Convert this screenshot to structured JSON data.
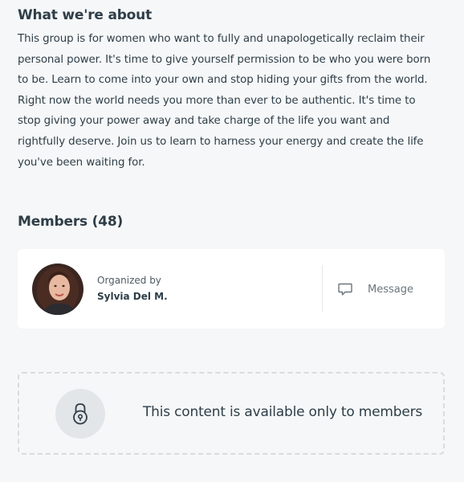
{
  "about": {
    "heading": "What we're about",
    "lines": [
      "This group is for women who want to fully and unapologetically reclaim their",
      "personal power. It's time to give yourself permission to be who you were born",
      "to be. Learn to come into your own and stop hiding your gifts from the world.",
      "Right now the world needs you more than ever to be authentic. It's time to",
      "stop giving your power away and take charge of the life you want and",
      "rightfully deserve. Join us to learn to harness your energy and create the life",
      "you've been waiting for."
    ]
  },
  "members": {
    "heading": "Members (48)"
  },
  "organizer": {
    "label": "Organized by",
    "name": "Sylvia Del M.",
    "avatar_icon": "organizer-avatar-photo",
    "message_label": "Message",
    "message_icon": "chat-bubble-icon"
  },
  "locked": {
    "icon": "lock-icon",
    "text": "This content is available only to members"
  },
  "colors": {
    "background": "#f6f7f8",
    "card": "#ffffff",
    "text": "#2e3e48",
    "muted": "#6b757c",
    "dashed_border": "#d9dcdf",
    "lock_circle": "#e3e6e9"
  }
}
